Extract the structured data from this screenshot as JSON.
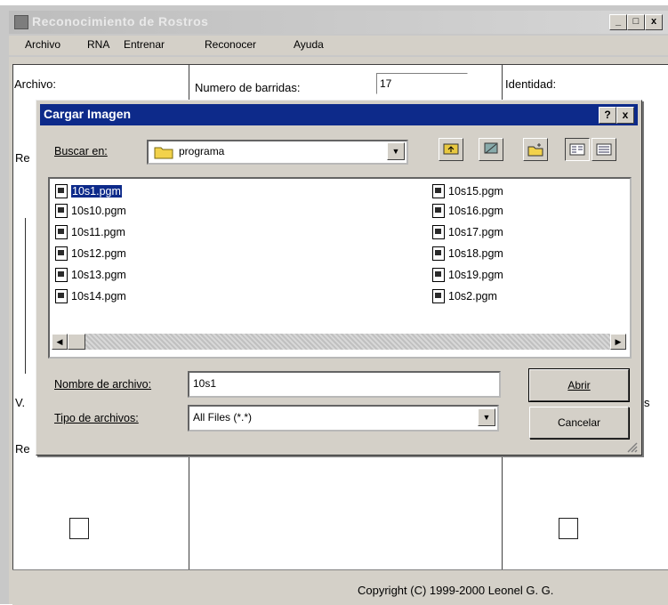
{
  "window": {
    "title": "Reconocimiento de Rostros",
    "min": "_",
    "max": "□",
    "close": "x"
  },
  "menubar": [
    "Archivo",
    "RNA",
    "Entrenar",
    "Reconocer",
    "Ayuda"
  ],
  "main": {
    "archivo_label": "Archivo:",
    "barridas_label": "Numero de barridas:",
    "barridas_value": "17",
    "identidad_label": "Identidad:",
    "re1_label": "Re",
    "v_label": "V.",
    "s_label": "s",
    "re2_label": "Re"
  },
  "status": "Copyright (C) 1999-2000 Leonel G. G.",
  "dialog": {
    "title": "Cargar Imagen",
    "help": "?",
    "close": "x",
    "buscar_label": "Buscar en:",
    "folder": "programa",
    "files_left": [
      "10s1.pgm",
      "10s10.pgm",
      "10s11.pgm",
      "10s12.pgm",
      "10s13.pgm",
      "10s14.pgm"
    ],
    "files_right": [
      "10s15.pgm",
      "10s16.pgm",
      "10s17.pgm",
      "10s18.pgm",
      "10s19.pgm",
      "10s2.pgm"
    ],
    "nombre_label": "Nombre de archivo:",
    "nombre_value": "10s1",
    "tipo_label": "Tipo de archivos:",
    "tipo_value": "All Files (*.*)",
    "abrir": "Abrir",
    "cancelar": "Cancelar"
  },
  "colors": {
    "titlebar_active": "#0d2a8a",
    "face": "#d4d0c8"
  }
}
